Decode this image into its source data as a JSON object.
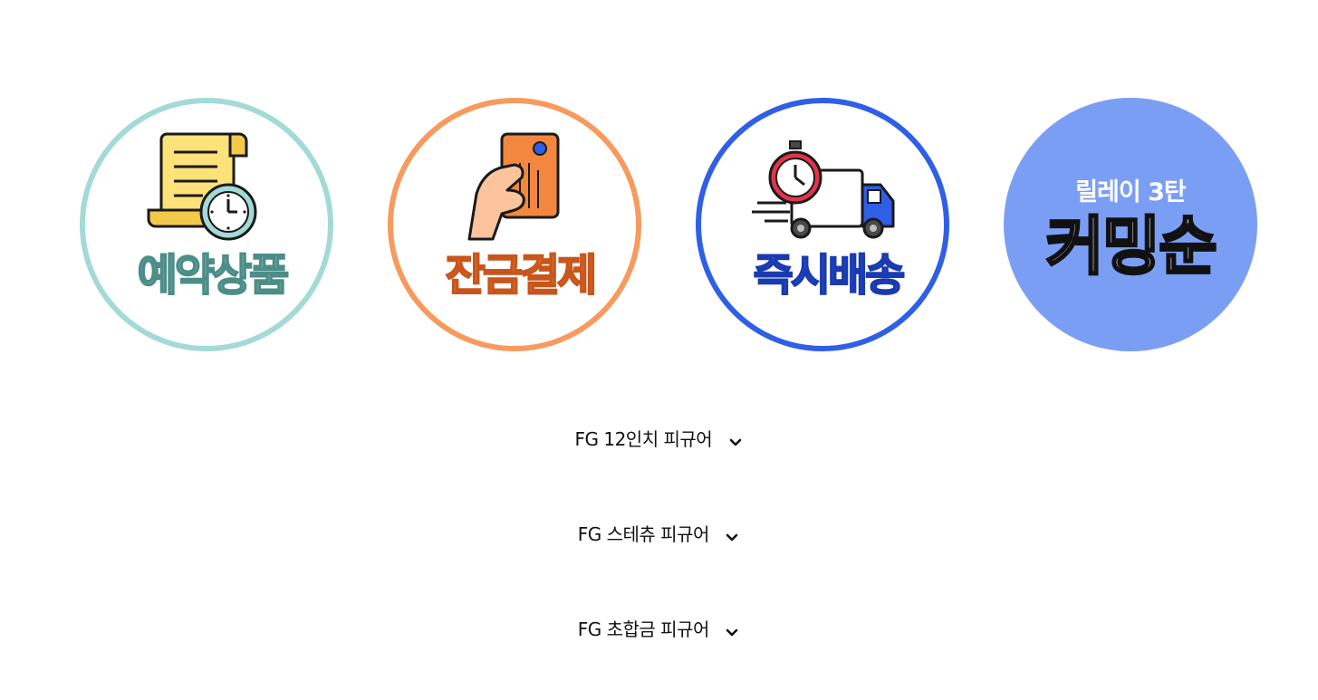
{
  "banners": [
    {
      "label": "예약상품",
      "icon": "scroll-clock-icon",
      "color": "#a3dad6"
    },
    {
      "label": "잔금결제",
      "icon": "card-in-hand-icon",
      "color": "#f89a5e"
    },
    {
      "label": "즉시배송",
      "icon": "delivery-truck-stopwatch-icon",
      "color": "#2f5fe6"
    },
    {
      "sub_label": "릴레이 3탄",
      "label": "커밍순",
      "color": "#7b9ef5"
    }
  ],
  "categories": [
    {
      "label": "FG 12인치 피규어",
      "icon": "chevron-down-icon"
    },
    {
      "label": "FG 스테츄 피규어",
      "icon": "chevron-down-icon"
    },
    {
      "label": "FG 초합금 피규어",
      "icon": "chevron-down-icon"
    }
  ]
}
